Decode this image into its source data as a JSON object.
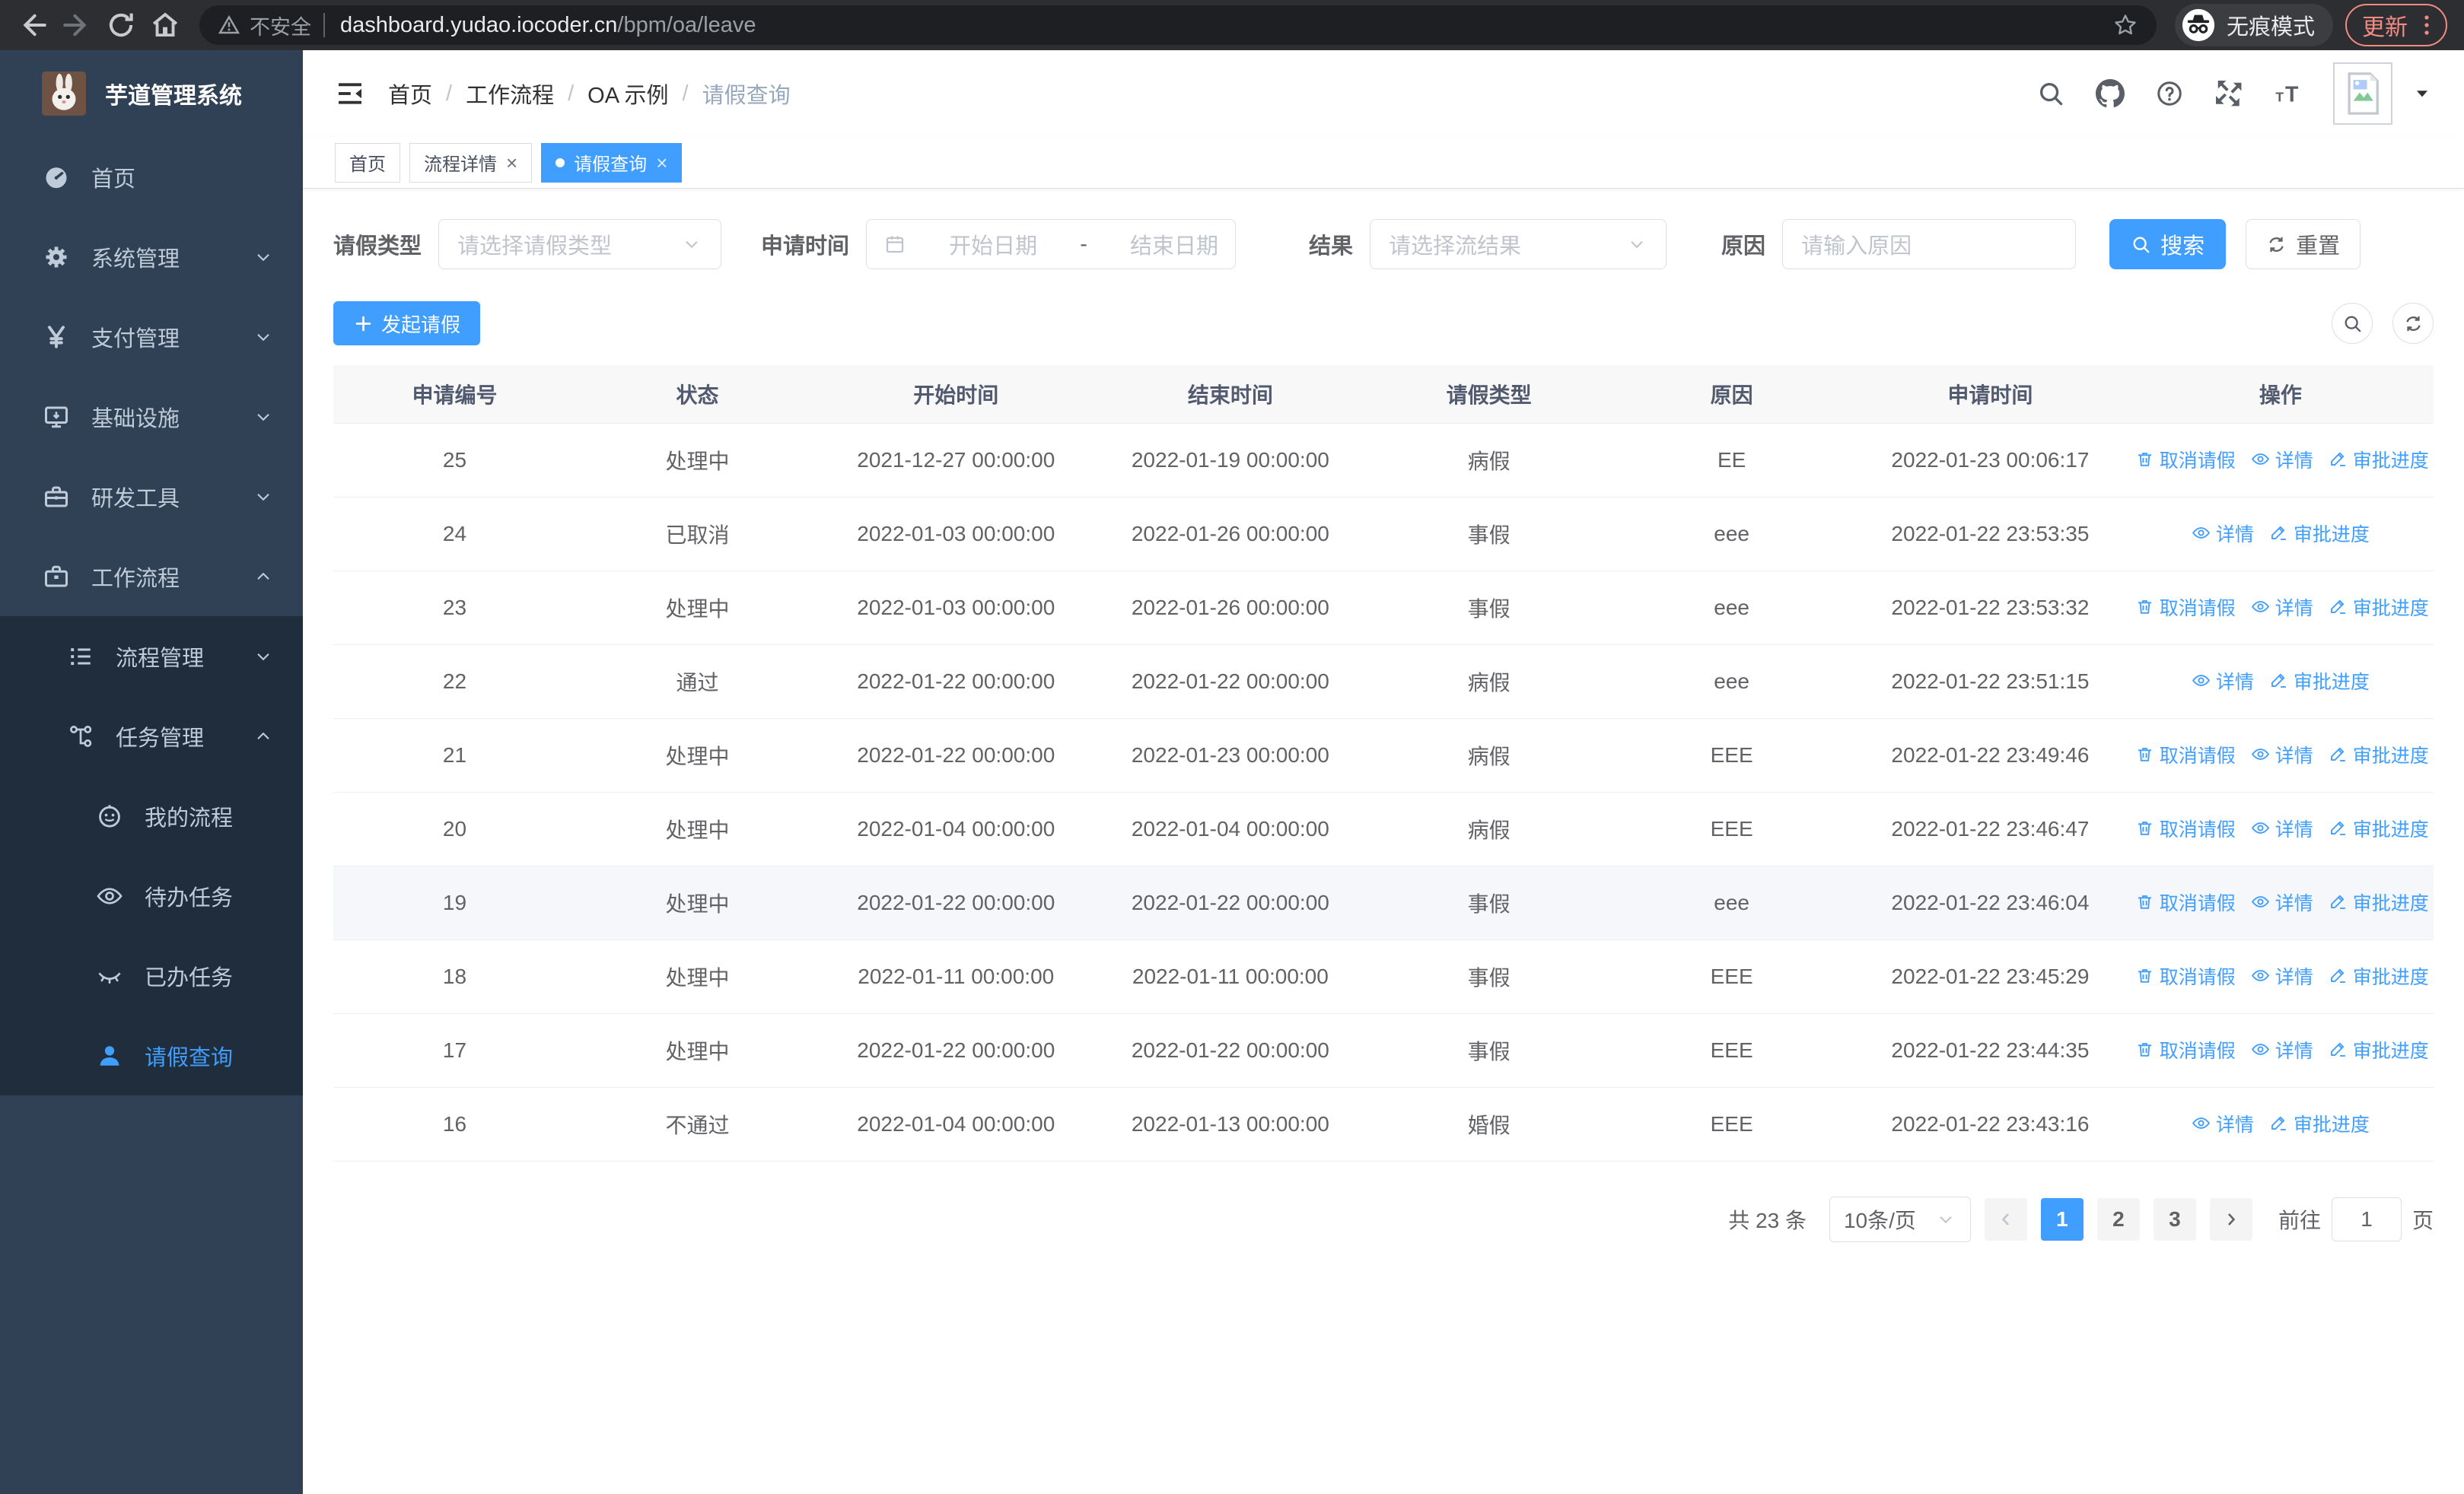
{
  "colors": {
    "accent": "#409eff",
    "sidebar_bg": "#304156",
    "submenu_bg": "#1f2d3d",
    "sidebar_text": "#bfcbd9",
    "update_salmon": "#f28b82",
    "header_bg": "#f8f8f9"
  },
  "browser": {
    "security_label": "不安全",
    "url_host": "dashboard.yudao.iocoder.cn",
    "url_path": "/bpm/oa/leave",
    "incognito_label": "无痕模式",
    "update_label": "更新"
  },
  "sidebar": {
    "title": "芋道管理系统",
    "items": [
      {
        "key": "home",
        "label": "首页",
        "icon": "dashboard-icon",
        "level": 0
      },
      {
        "key": "system-management",
        "label": "系统管理",
        "icon": "gear-icon",
        "level": 0,
        "chevron": "down"
      },
      {
        "key": "payment-management",
        "label": "支付管理",
        "icon": "yen-icon",
        "level": 0,
        "chevron": "down"
      },
      {
        "key": "infrastructure",
        "label": "基础设施",
        "icon": "monitor-icon",
        "level": 0,
        "chevron": "down"
      },
      {
        "key": "dev-tools",
        "label": "研发工具",
        "icon": "toolbox-icon",
        "level": 0,
        "chevron": "down"
      },
      {
        "key": "workflow",
        "label": "工作流程",
        "icon": "briefcase-icon",
        "level": 0,
        "chevron": "up"
      },
      {
        "key": "process-management",
        "label": "流程管理",
        "icon": "list-icon",
        "level": 1,
        "sub": true,
        "chevron": "down"
      },
      {
        "key": "task-management",
        "label": "任务管理",
        "icon": "tree-icon",
        "level": 1,
        "sub": true,
        "chevron": "up"
      },
      {
        "key": "my-process",
        "label": "我的流程",
        "icon": "robot-icon",
        "level": 2,
        "sub": true
      },
      {
        "key": "todo-tasks",
        "label": "待办任务",
        "icon": "eye-icon",
        "level": 2,
        "sub": true
      },
      {
        "key": "done-tasks",
        "label": "已办任务",
        "icon": "eye-closed-icon",
        "level": 2,
        "sub": true
      },
      {
        "key": "leave-query",
        "label": "请假查询",
        "icon": "user-icon",
        "level": 2,
        "sub": true,
        "active": true
      }
    ]
  },
  "header": {
    "breadcrumb": [
      "首页",
      "工作流程",
      "OA 示例",
      "请假查询"
    ]
  },
  "tabs": [
    {
      "label": "首页"
    },
    {
      "label": "流程详情",
      "closable": true
    },
    {
      "label": "请假查询",
      "closable": true,
      "active": true
    }
  ],
  "filters": {
    "type_label": "请假类型",
    "type_placeholder": "请选择请假类型",
    "time_label": "申请时间",
    "start_placeholder": "开始日期",
    "range_separator": "-",
    "end_placeholder": "结束日期",
    "result_label": "结果",
    "result_placeholder": "请选择流结果",
    "reason_label": "原因",
    "reason_placeholder": "请输入原因",
    "search_label": "搜索",
    "reset_label": "重置"
  },
  "toolbar": {
    "create_label": "发起请假"
  },
  "table": {
    "headers": [
      "申请编号",
      "状态",
      "开始时间",
      "结束时间",
      "请假类型",
      "原因",
      "申请时间",
      "操作"
    ],
    "action_labels": {
      "cancel": "取消请假",
      "detail": "详情",
      "progress": "审批进度"
    },
    "rows": [
      {
        "id": "25",
        "status": "处理中",
        "start": "2021-12-27 00:00:00",
        "end": "2022-01-19 00:00:00",
        "type": "病假",
        "reason": "EE",
        "applied": "2022-01-23 00:06:17",
        "actions": [
          "cancel",
          "detail",
          "progress"
        ]
      },
      {
        "id": "24",
        "status": "已取消",
        "start": "2022-01-03 00:00:00",
        "end": "2022-01-26 00:00:00",
        "type": "事假",
        "reason": "eee",
        "applied": "2022-01-22 23:53:35",
        "actions": [
          "detail",
          "progress"
        ]
      },
      {
        "id": "23",
        "status": "处理中",
        "start": "2022-01-03 00:00:00",
        "end": "2022-01-26 00:00:00",
        "type": "事假",
        "reason": "eee",
        "applied": "2022-01-22 23:53:32",
        "actions": [
          "cancel",
          "detail",
          "progress"
        ]
      },
      {
        "id": "22",
        "status": "通过",
        "start": "2022-01-22 00:00:00",
        "end": "2022-01-22 00:00:00",
        "type": "病假",
        "reason": "eee",
        "applied": "2022-01-22 23:51:15",
        "actions": [
          "detail",
          "progress"
        ]
      },
      {
        "id": "21",
        "status": "处理中",
        "start": "2022-01-22 00:00:00",
        "end": "2022-01-23 00:00:00",
        "type": "病假",
        "reason": "EEE",
        "applied": "2022-01-22 23:49:46",
        "actions": [
          "cancel",
          "detail",
          "progress"
        ]
      },
      {
        "id": "20",
        "status": "处理中",
        "start": "2022-01-04 00:00:00",
        "end": "2022-01-04 00:00:00",
        "type": "病假",
        "reason": "EEE",
        "applied": "2022-01-22 23:46:47",
        "actions": [
          "cancel",
          "detail",
          "progress"
        ]
      },
      {
        "id": "19",
        "status": "处理中",
        "start": "2022-01-22 00:00:00",
        "end": "2022-01-22 00:00:00",
        "type": "事假",
        "reason": "eee",
        "applied": "2022-01-22 23:46:04",
        "actions": [
          "cancel",
          "detail",
          "progress"
        ],
        "highlight": true
      },
      {
        "id": "18",
        "status": "处理中",
        "start": "2022-01-11 00:00:00",
        "end": "2022-01-11 00:00:00",
        "type": "事假",
        "reason": "EEE",
        "applied": "2022-01-22 23:45:29",
        "actions": [
          "cancel",
          "detail",
          "progress"
        ]
      },
      {
        "id": "17",
        "status": "处理中",
        "start": "2022-01-22 00:00:00",
        "end": "2022-01-22 00:00:00",
        "type": "事假",
        "reason": "EEE",
        "applied": "2022-01-22 23:44:35",
        "actions": [
          "cancel",
          "detail",
          "progress"
        ]
      },
      {
        "id": "16",
        "status": "不通过",
        "start": "2022-01-04 00:00:00",
        "end": "2022-01-13 00:00:00",
        "type": "婚假",
        "reason": "EEE",
        "applied": "2022-01-22 23:43:16",
        "actions": [
          "detail",
          "progress"
        ]
      }
    ]
  },
  "pagination": {
    "total_label": "共 23 条",
    "page_size": "10条/页",
    "pages": [
      "1",
      "2",
      "3"
    ],
    "active_page": "1",
    "goto_label": "前往",
    "goto_value": "1",
    "unit_label": "页"
  }
}
